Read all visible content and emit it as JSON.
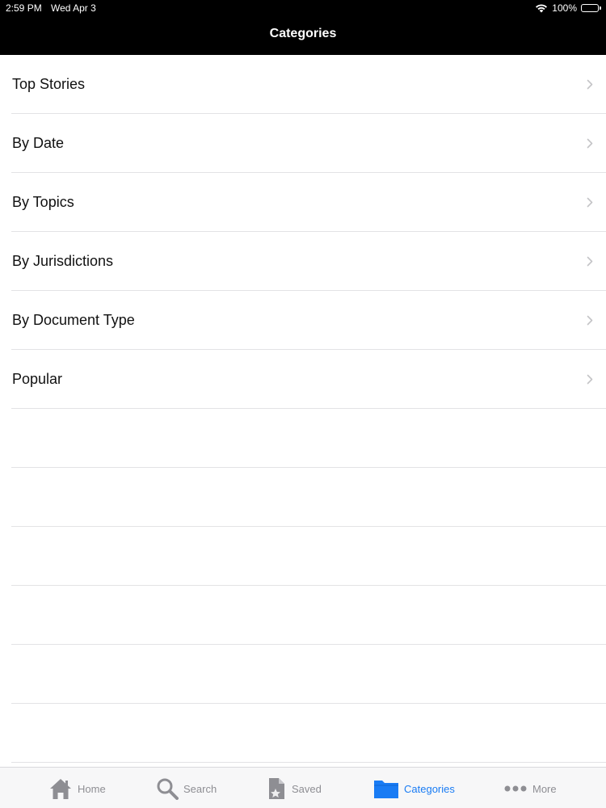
{
  "status_bar": {
    "time": "2:59 PM",
    "date": "Wed Apr 3",
    "battery": "100%",
    "battery_level": 1.0
  },
  "nav": {
    "title": "Categories"
  },
  "list": {
    "items": [
      {
        "label": "Top Stories"
      },
      {
        "label": "By Date"
      },
      {
        "label": "By Topics"
      },
      {
        "label": "By Jurisdictions"
      },
      {
        "label": "By Document Type"
      },
      {
        "label": "Popular"
      }
    ]
  },
  "tabs": [
    {
      "label": "Home",
      "icon": "home-icon"
    },
    {
      "label": "Search",
      "icon": "search-icon"
    },
    {
      "label": "Saved",
      "icon": "saved-document-icon"
    },
    {
      "label": "Categories",
      "icon": "folder-icon",
      "active": true
    },
    {
      "label": "More",
      "icon": "more-dots-icon"
    }
  ],
  "colors": {
    "accent": "#1a7cf4",
    "inactive": "#8e8e93",
    "bar_background": "#000000"
  }
}
